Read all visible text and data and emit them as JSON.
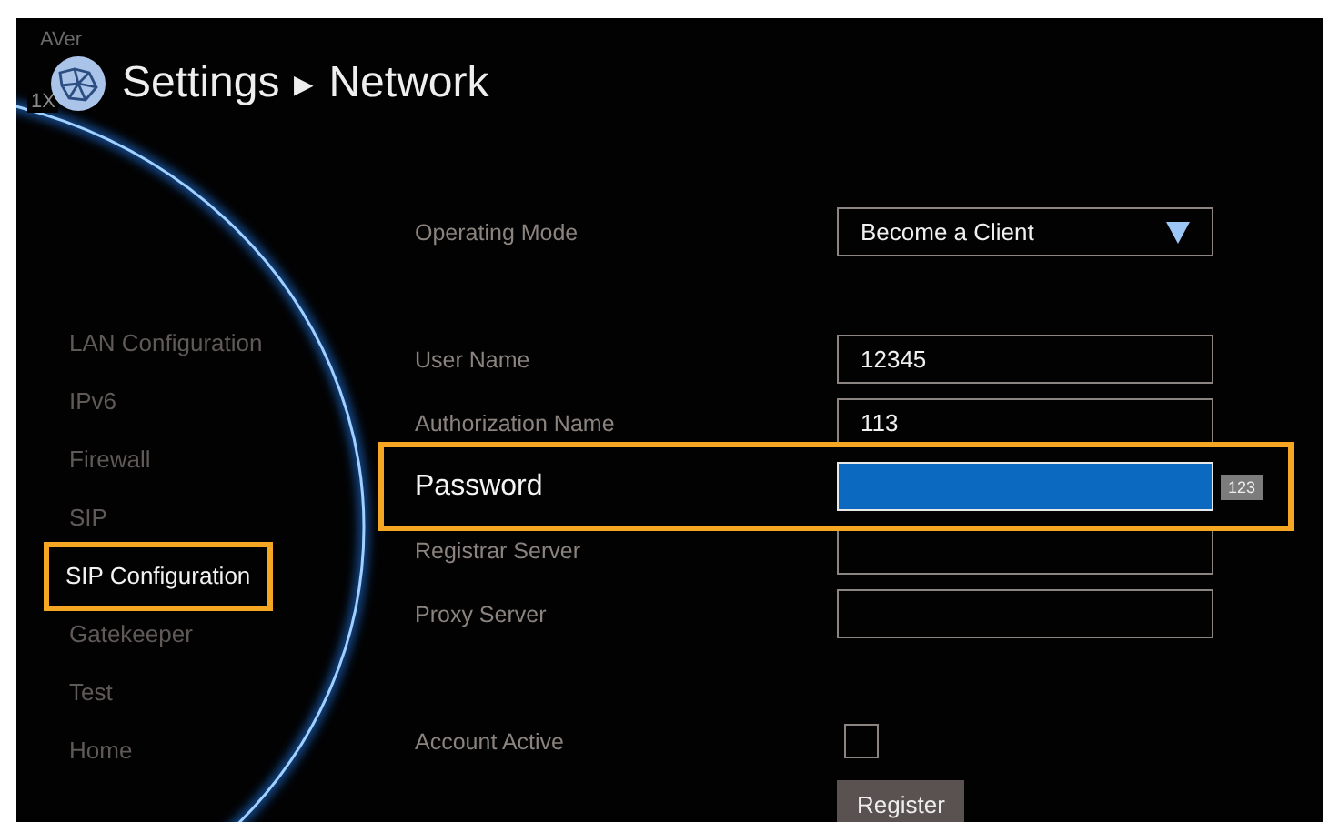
{
  "header": {
    "brand": "AVer",
    "zoom": "1X",
    "title": "Settings",
    "separator": "▶",
    "subtitle": "Network"
  },
  "sidebar": {
    "items": [
      {
        "label": "LAN Configuration",
        "selected": false
      },
      {
        "label": "IPv6",
        "selected": false
      },
      {
        "label": "Firewall",
        "selected": false
      },
      {
        "label": "SIP",
        "selected": false
      },
      {
        "label": "SIP Configuration",
        "selected": true
      },
      {
        "label": "Gatekeeper",
        "selected": false
      },
      {
        "label": "Test",
        "selected": false
      },
      {
        "label": "Home",
        "selected": false
      }
    ]
  },
  "form": {
    "sections": [
      [
        {
          "kind": "dropdown",
          "label": "Operating Mode",
          "value": "Become a Client",
          "focused": false
        }
      ],
      [
        {
          "kind": "text",
          "label": "User Name",
          "value": "12345",
          "focused": false
        },
        {
          "kind": "text",
          "label": "Authorization Name",
          "value": "113",
          "focused": false
        },
        {
          "kind": "text",
          "label": "Password",
          "focused": true,
          "badge": "123"
        },
        {
          "kind": "text",
          "label": "Registrar Server",
          "focused": false
        },
        {
          "kind": "text",
          "label": "Proxy Server",
          "focused": false
        }
      ],
      [
        {
          "kind": "checkbox",
          "label": "Account Active",
          "checked": false
        }
      ]
    ],
    "button": "Register"
  }
}
